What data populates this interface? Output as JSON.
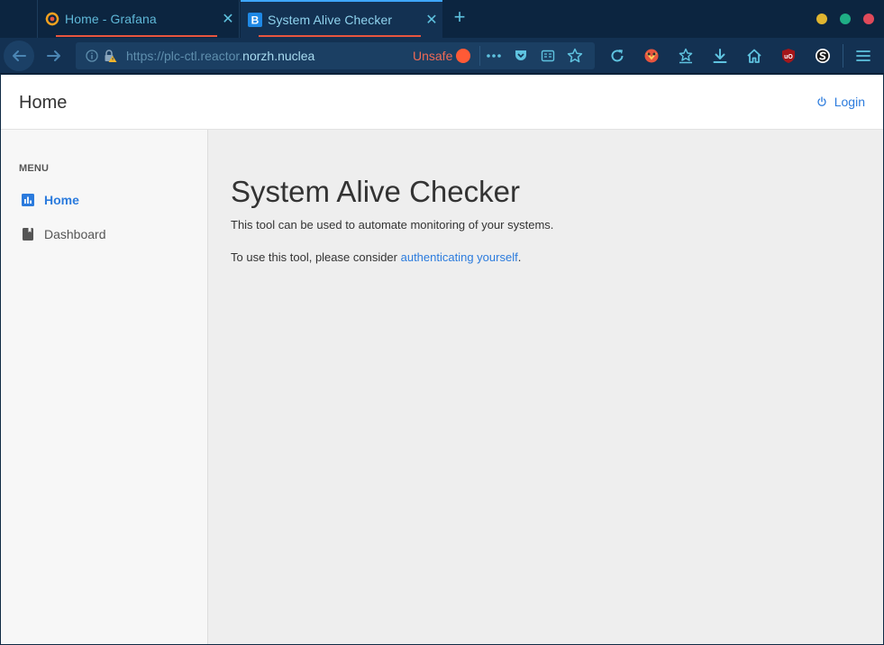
{
  "browser": {
    "tabs": [
      {
        "title": "Home - Grafana",
        "favicon": "grafana-logo-icon",
        "active": false
      },
      {
        "title": "System Alive Checker",
        "favicon": "b-letter-icon",
        "favicon_letter": "B",
        "active": true
      }
    ],
    "url": {
      "prefix": "https://plc-ctl.reactor.",
      "host": "norzh.nuclea",
      "unsafe_label": "Unsafe"
    },
    "colors": {
      "accent": "#5fc3e0",
      "unsafe": "#ef6a56",
      "tab_underline": "#e8553f"
    }
  },
  "page": {
    "header_title": "Home",
    "login_label": "Login",
    "menu_label": "MENU",
    "menu_items": [
      {
        "label": "Home",
        "icon": "bar-chart-icon",
        "active": true
      },
      {
        "label": "Dashboard",
        "icon": "book-icon",
        "active": false
      }
    ],
    "main": {
      "title": "System Alive Checker",
      "description": "This tool can be used to automate monitoring of your systems.",
      "auth_prefix": "To use this tool, please consider ",
      "auth_link": "authenticating yourself",
      "auth_suffix": "."
    },
    "colors": {
      "link": "#2b7bdd"
    }
  }
}
